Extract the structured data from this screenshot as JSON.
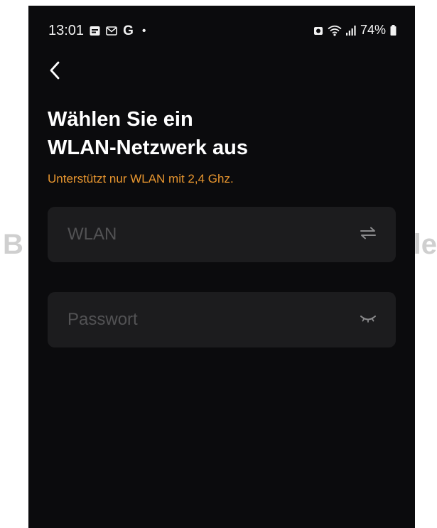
{
  "watermark": {
    "left_text": "B",
    "right_text": "le"
  },
  "status_bar": {
    "time": "13:01",
    "g_label": "G",
    "dot": "•",
    "battery": "74%"
  },
  "header": {
    "title_line1": "Wählen Sie ein",
    "title_line2": "WLAN-Netzwerk aus",
    "subtitle": "Unterstützt nur WLAN mit 2,4 Ghz."
  },
  "form": {
    "wlan": {
      "placeholder": "WLAN",
      "value": "",
      "action_icon": "swap-arrows-icon"
    },
    "password": {
      "placeholder": "Passwort",
      "value": "",
      "action_icon": "eye-closed-icon"
    }
  },
  "colors": {
    "background": "#0b0b0d",
    "field_background": "#1c1c1e",
    "accent_orange": "#e8962f",
    "placeholder": "#525254"
  }
}
